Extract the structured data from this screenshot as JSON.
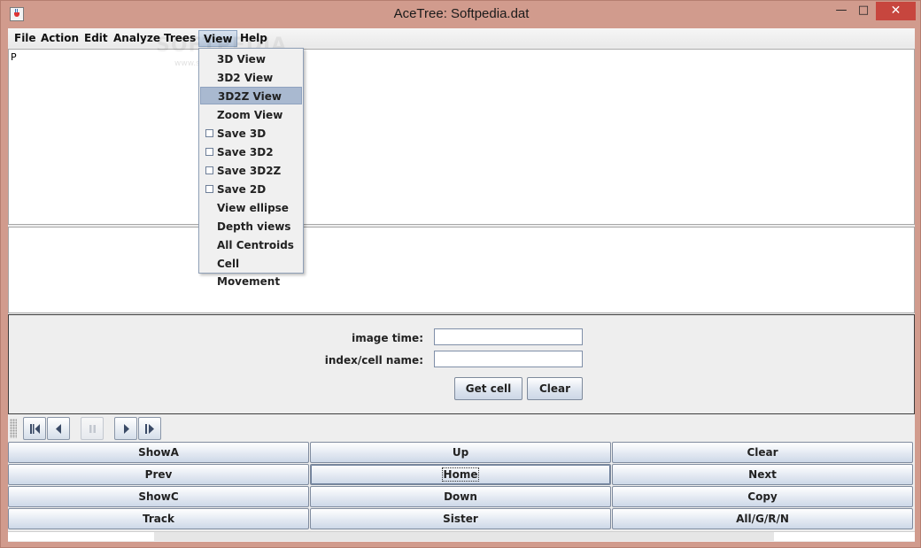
{
  "window": {
    "title": "AceTree: Softpedia.dat",
    "minimize_glyph": "—",
    "maximize_glyph": "□",
    "close_glyph": "✕"
  },
  "menubar": {
    "items": [
      {
        "label": "File"
      },
      {
        "label": "Action"
      },
      {
        "label": "Edit"
      },
      {
        "label": "Analyze"
      },
      {
        "label": "Trees"
      },
      {
        "label": "View"
      },
      {
        "label": "Help"
      }
    ]
  },
  "view_menu": {
    "items": [
      {
        "label": "3D View",
        "checkbox": false
      },
      {
        "label": "3D2 View",
        "checkbox": false
      },
      {
        "label": "3D2Z View",
        "checkbox": false,
        "highlighted": true
      },
      {
        "label": "Zoom View",
        "checkbox": false
      },
      {
        "label": "Save 3D",
        "checkbox": true,
        "checked": false
      },
      {
        "label": "Save 3D2",
        "checkbox": true,
        "checked": false
      },
      {
        "label": "Save 3D2Z",
        "checkbox": true,
        "checked": false
      },
      {
        "label": "Save 2D",
        "checkbox": true,
        "checked": false
      },
      {
        "label": "View ellipse",
        "checkbox": false
      },
      {
        "label": "Depth views",
        "checkbox": false
      },
      {
        "label": "All Centroids",
        "checkbox": false
      },
      {
        "label": "Cell Movement",
        "checkbox": false
      }
    ]
  },
  "tree_pane": {
    "text": "P"
  },
  "watermark": {
    "text": "SOFTPEDIA",
    "sub": "www.softpedia.com"
  },
  "form": {
    "image_time_label": "image time:",
    "image_time_value": "",
    "index_label": "index/cell name:",
    "index_value": "",
    "get_cell_label": "Get cell",
    "clear_label": "Clear"
  },
  "toolbar": {
    "icons": [
      "skip-back-icon",
      "step-back-icon",
      "pause-icon",
      "play-icon",
      "step-forward-icon"
    ]
  },
  "buttons": {
    "rows": [
      [
        "ShowA",
        "Up",
        "Clear"
      ],
      [
        "Prev",
        "Home",
        "Next"
      ],
      [
        "ShowC",
        "Down",
        "Copy"
      ],
      [
        "Track",
        "Sister",
        "All/G/R/N"
      ]
    ],
    "focused": "Home"
  }
}
